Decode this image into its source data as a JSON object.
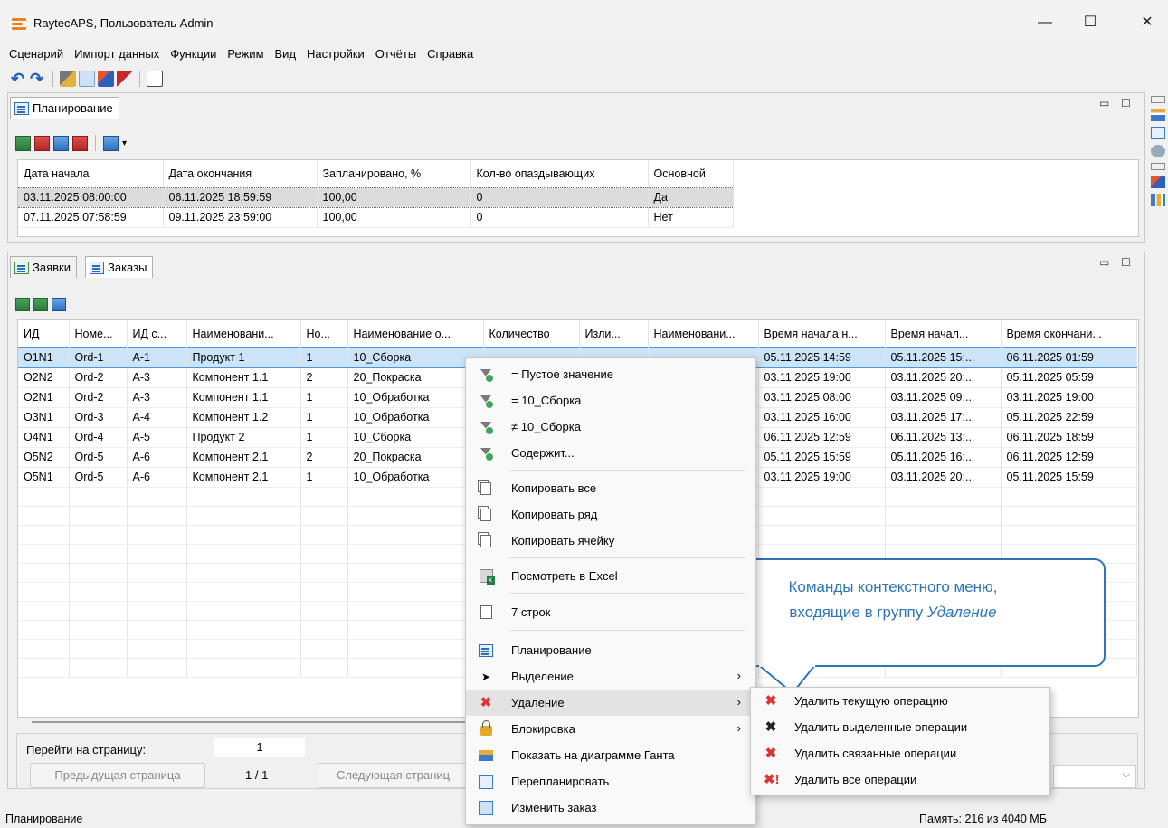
{
  "window": {
    "title": "RaytecAPS, Пользователь Admin",
    "minimize": "—",
    "maximize": "☐",
    "close": "✕"
  },
  "menu": [
    "Сценарий",
    "Импорт данных",
    "Функции",
    "Режим",
    "Вид",
    "Настройки",
    "Отчёты",
    "Справка"
  ],
  "planning_panel": {
    "tab_label": "Планирование",
    "columns": [
      "Дата начала",
      "Дата окончания",
      "Запланировано, %",
      "Кол-во опаздывающих",
      "Основной"
    ],
    "rows": [
      [
        "03.11.2025 08:00:00",
        "06.11.2025 18:59:59",
        "100,00",
        "0",
        "Да"
      ],
      [
        "07.11.2025 07:58:59",
        "09.11.2025 23:59:00",
        "100,00",
        "0",
        "Нет"
      ]
    ]
  },
  "orders_panel": {
    "tabs": [
      "Заявки",
      "Заказы"
    ],
    "columns": [
      "ИД",
      "Номе...",
      "ИД с...",
      "Наименовани...",
      "Но...",
      "Наименование о...",
      "Количество",
      "Изли...",
      "Наименовани...",
      "Время начала н...",
      "Время начал...",
      "Время окончани..."
    ],
    "rows": [
      [
        "O1N1",
        "Ord-1",
        "A-1",
        "Продукт 1",
        "1",
        "10_Сборка",
        "",
        "",
        "",
        "05.11.2025 14:59",
        "05.11.2025 15:...",
        "06.11.2025 01:59"
      ],
      [
        "O2N2",
        "Ord-2",
        "A-3",
        "Компонент 1.1",
        "2",
        "20_Покраска",
        "",
        "",
        "",
        "03.11.2025 19:00",
        "03.11.2025 20:...",
        "05.11.2025 05:59"
      ],
      [
        "O2N1",
        "Ord-2",
        "A-3",
        "Компонент 1.1",
        "1",
        "10_Обработка",
        "",
        "",
        "",
        "03.11.2025 08:00",
        "03.11.2025 09:...",
        "03.11.2025 19:00"
      ],
      [
        "O3N1",
        "Ord-3",
        "A-4",
        "Компонент 1.2",
        "1",
        "10_Обработка",
        "",
        "",
        "",
        "03.11.2025 16:00",
        "03.11.2025 17:...",
        "05.11.2025 22:59"
      ],
      [
        "O4N1",
        "Ord-4",
        "A-5",
        "Продукт 2",
        "1",
        "10_Сборка",
        "",
        "",
        "",
        "06.11.2025 12:59",
        "06.11.2025 13:...",
        "06.11.2025 18:59"
      ],
      [
        "O5N2",
        "Ord-5",
        "A-6",
        "Компонент 2.1",
        "2",
        "20_Покраска",
        "",
        "",
        "",
        "05.11.2025 15:59",
        "05.11.2025 16:...",
        "06.11.2025 12:59"
      ],
      [
        "O5N1",
        "Ord-5",
        "A-6",
        "Компонент 2.1",
        "1",
        "10_Обработка",
        "",
        "",
        "",
        "03.11.2025 19:00",
        "03.11.2025 20:...",
        "05.11.2025 15:59"
      ]
    ],
    "empty_rows": 10
  },
  "navigation": {
    "goto_label": "Перейти на страницу:",
    "page_input": "1",
    "prev": "Предыдущая страница",
    "page_of": "1 / 1",
    "next": "Следующая страниц"
  },
  "context_menu": {
    "filters": [
      "= Пустое значение",
      "= 10_Сборка",
      "≠ 10_Сборка",
      "Содержит..."
    ],
    "copy": [
      "Копировать все",
      "Копировать ряд",
      "Копировать ячейку"
    ],
    "excel": "Посмотреть в Excel",
    "rows": "7 строк",
    "planning": "Планирование",
    "selection": "Выделение",
    "delete": "Удаление",
    "lock": "Блокировка",
    "gantt": "Показать на диаграмме Ганта",
    "replan": "Перепланировать",
    "edit_order": "Изменить заказ"
  },
  "submenu": [
    "Удалить текущую операцию",
    "Удалить выделенные операции",
    "Удалить связанные операции",
    "Удалить все операции"
  ],
  "callout": {
    "line1": "Команды контекстного меню,",
    "line2_prefix": "входящие в группу ",
    "line2_em": "Удаление"
  },
  "status": {
    "left": "Планирование",
    "right": "Память: 216 из 4040 МБ"
  },
  "colors": {
    "accent": "#2e75b6",
    "delete": "#dd3333",
    "selected_row": "#cce4f7"
  }
}
